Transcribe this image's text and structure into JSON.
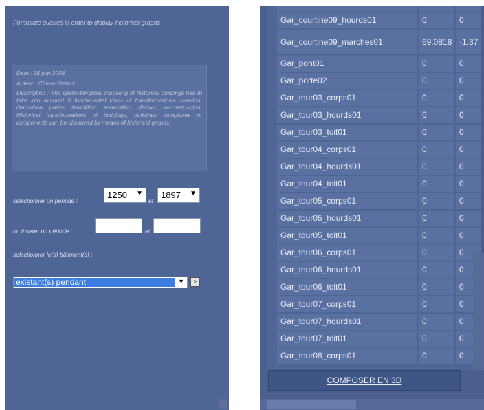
{
  "left": {
    "intro": "Formulate queries in order to display historical graphs",
    "description": {
      "date": "Date : 15 juin 2008",
      "author": "Auteur : Chiara Stefani",
      "text": "Description : The spatio-temporal modeling of historical buildings has to take into account 6 fundamental kinds of transformations: creation, demolition, partial demolition, annexation, division, reconstruction. Historical transformations of buildings, buildings complexes or components can be displayed by means of historical graphs."
    },
    "period_select": {
      "label": "selectionner un période :",
      "from": "1250",
      "et": "et",
      "to": "1897"
    },
    "period_input": {
      "label": "ou inserer un période :",
      "from": "",
      "et": "et",
      "to": ""
    },
    "building_select": {
      "label": "selectionner le(s) bâtiment(s) :",
      "value": "existant(s) pendant",
      "go_label": ">"
    }
  },
  "right": {
    "rows": [
      {
        "name": "Gar_courtine09_hourds01",
        "v1": "0",
        "v2": "0"
      },
      {
        "name": "Gar_courtine09_marches01",
        "v1": "69.0818",
        "v2": "-1.37"
      },
      {
        "name": "Gar_pont01",
        "v1": "0",
        "v2": "0"
      },
      {
        "name": "Gar_porte02",
        "v1": "0",
        "v2": "0"
      },
      {
        "name": "Gar_tour03_corps01",
        "v1": "0",
        "v2": "0"
      },
      {
        "name": "Gar_tour03_hourds01",
        "v1": "0",
        "v2": "0"
      },
      {
        "name": "Gar_tour03_toit01",
        "v1": "0",
        "v2": "0"
      },
      {
        "name": "Gar_tour04_corps01",
        "v1": "0",
        "v2": "0"
      },
      {
        "name": "Gar_tour04_hourds01",
        "v1": "0",
        "v2": "0"
      },
      {
        "name": "Gar_tour04_toit01",
        "v1": "0",
        "v2": "0"
      },
      {
        "name": "Gar_tour05_corps01",
        "v1": "0",
        "v2": "0"
      },
      {
        "name": "Gar_tour05_hourds01",
        "v1": "0",
        "v2": "0"
      },
      {
        "name": "Gar_tour05_toit01",
        "v1": "0",
        "v2": "0"
      },
      {
        "name": "Gar_tour06_corps01",
        "v1": "0",
        "v2": "0"
      },
      {
        "name": "Gar_tour06_hourds01",
        "v1": "0",
        "v2": "0"
      },
      {
        "name": "Gar_tour06_toit01",
        "v1": "0",
        "v2": "0"
      },
      {
        "name": "Gar_tour07_corps01",
        "v1": "0",
        "v2": "0"
      },
      {
        "name": "Gar_tour07_hourds01",
        "v1": "0",
        "v2": "0"
      },
      {
        "name": "Gar_tour07_toit01",
        "v1": "0",
        "v2": "0"
      },
      {
        "name": "Gar_tour08_corps01",
        "v1": "0",
        "v2": "0"
      }
    ],
    "compose_label": "COMPOSER EN 3D"
  },
  "icons": {
    "dropdown": "chevron-down-icon",
    "go": "arrow-right-icon"
  }
}
